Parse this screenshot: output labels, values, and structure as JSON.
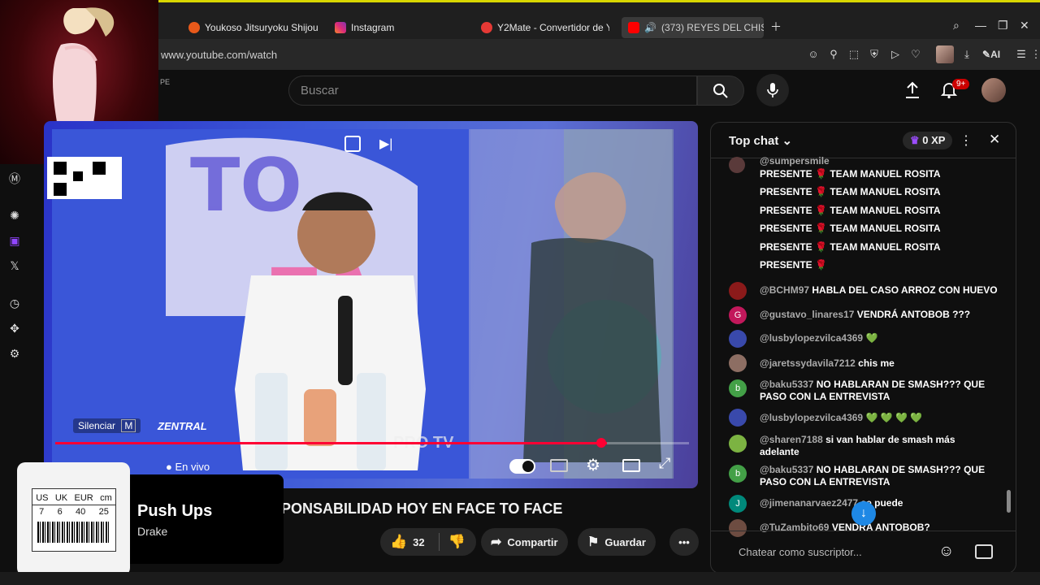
{
  "browser": {
    "tabs": [
      {
        "label": "Youkoso Jitsuryoku Shijou"
      },
      {
        "label": "Instagram"
      },
      {
        "label": "Y2Mate - Convertidor de Y"
      },
      {
        "label": "(373) REYES DEL CHIS"
      }
    ],
    "url": "www.youtube.com/watch",
    "ai_label": "AI"
  },
  "youtube": {
    "logo_suffix": "PE",
    "search_placeholder": "Buscar",
    "notif_badge": "9+"
  },
  "video": {
    "mute_label": "Silenciar",
    "mute_key": "M",
    "live_label": "En vivo",
    "title_visible": "PONSABILIDAD HOY EN FACE TO FACE",
    "likes": "32",
    "share_label": "Compartir",
    "save_label": "Guardar",
    "overlay_brand": "ZENTRAL",
    "overlay_tv": "PRO TV",
    "colors": {
      "progress": "#ff0033",
      "accent_blue": "#3d5ad8"
    }
  },
  "chat": {
    "title": "Top chat",
    "xp": "0 XP",
    "input_placeholder": "Chatear como suscriptor...",
    "pinned_author": "@sumpersmile",
    "repeated_lines": [
      {
        "left": "PRESENTE",
        "right": "TEAM MANUEL ROSITA"
      },
      {
        "left": "PRESENTE",
        "right": "TEAM MANUEL ROSITA"
      },
      {
        "left": "PRESENTE",
        "right": "TEAM MANUEL ROSITA"
      },
      {
        "left": "PRESENTE",
        "right": "TEAM MANUEL ROSITA"
      },
      {
        "left": "PRESENTE",
        "right": "TEAM MANUEL ROSITA"
      },
      {
        "left": "PRESENTE",
        "right": ""
      }
    ],
    "messages": [
      {
        "author": "@BCHM97",
        "text": "HABLA DEL CASO ARROZ CON HUEVO",
        "avatar": "",
        "color": "#8b1a1a"
      },
      {
        "author": "@gustavo_linares17",
        "text": "VENDRÁ ANTOBOB ???",
        "avatar": "G",
        "color": "#c2185b"
      },
      {
        "author": "@lusbylopezvilca4369",
        "text": "💚",
        "avatar": "",
        "color": "#3949ab"
      },
      {
        "author": "@jaretssydavila7212",
        "text": "chis me",
        "avatar": "",
        "color": "#8d6e63"
      },
      {
        "author": "@baku5337",
        "text": "NO HABLARAN DE SMASH??? QUE PASO CON LA ENTREVISTA",
        "avatar": "b",
        "color": "#43a047"
      },
      {
        "author": "@lusbylopezvilca4369",
        "text": "💚 💚 💚 💚",
        "avatar": "",
        "color": "#3949ab"
      },
      {
        "author": "@sharen7188",
        "text": "si van hablar de smash más adelante",
        "avatar": "",
        "color": "#7cb342"
      },
      {
        "author": "@baku5337",
        "text": "NO HABLARAN DE SMASH??? QUE PASO CON LA ENTREVISTA",
        "avatar": "b",
        "color": "#43a047"
      },
      {
        "author": "@jimenanarvaez2477",
        "text": "se puede",
        "avatar": "J",
        "color": "#00897b"
      },
      {
        "author": "@TuZambito69",
        "text": "VENDRA ANTOBOB?",
        "avatar": "",
        "color": "#6d4c41"
      }
    ]
  },
  "music": {
    "title": "Push Ups",
    "artist": "Drake",
    "size_header": [
      "US",
      "UK",
      "EUR",
      "cm"
    ],
    "size_values": [
      "7",
      "6",
      "40",
      "25"
    ]
  }
}
